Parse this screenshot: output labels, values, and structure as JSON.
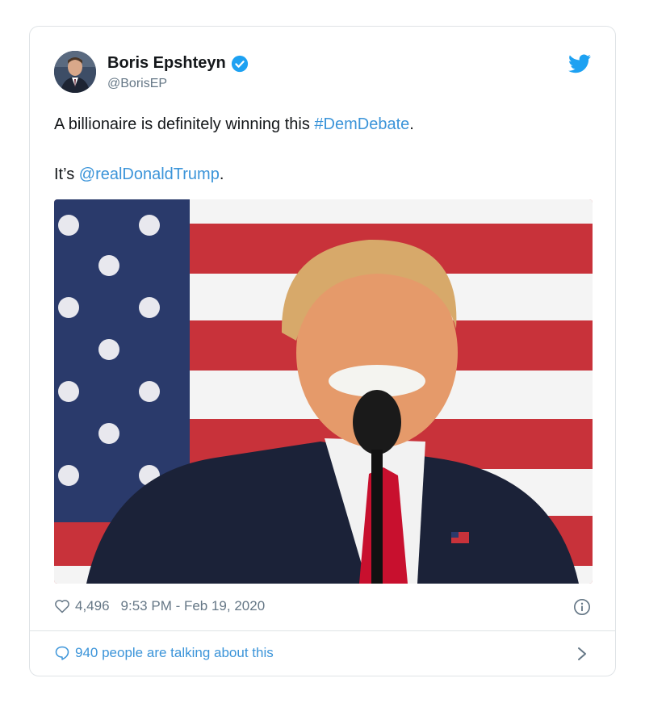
{
  "tweet": {
    "author_name": "Boris Epshteyn",
    "handle": "@BorisEP",
    "line1_prefix": "A billionaire is definitely winning this ",
    "hashtag": "#DemDebate",
    "line1_suffix": ".",
    "line2_prefix": "It’s ",
    "mention": "@realDonaldTrump",
    "line2_suffix": ".",
    "likes": "4,496",
    "timestamp": "9:53 PM - Feb 19, 2020",
    "discussion": "940 people are talking about this"
  },
  "colors": {
    "link": "#3b94d9",
    "muted": "#657786",
    "verified": "#1da1f2",
    "flag_red": "#c8323a",
    "flag_blue": "#2a3a6b"
  },
  "icons": [
    "verified-badge-icon",
    "twitter-bird-icon",
    "heart-icon",
    "info-icon",
    "speech-bubble-icon",
    "chevron-right-icon"
  ]
}
